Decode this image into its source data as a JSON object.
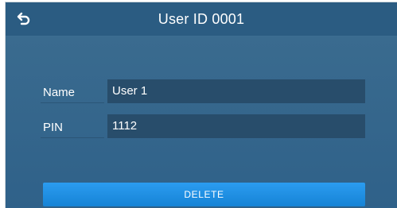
{
  "header": {
    "title": "User ID 0001",
    "back_icon": "back-arrow-icon"
  },
  "form": {
    "name_label": "Name",
    "name_value": "User 1",
    "pin_label": "PIN",
    "pin_value": "1112"
  },
  "actions": {
    "delete_label": "DELETE"
  },
  "colors": {
    "background": "#2f5f82",
    "field": "#284d6b",
    "button": "#1e8ee3"
  }
}
